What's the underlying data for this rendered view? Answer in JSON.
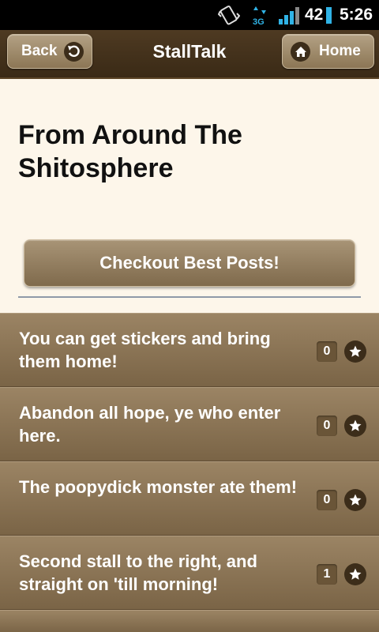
{
  "status_bar": {
    "battery": "42",
    "time": "5:26",
    "data_label": "3G",
    "icons": [
      "vibrate-icon",
      "data-3g-icon",
      "signal-icon",
      "battery-icon"
    ],
    "battery_color": "#30b3e6"
  },
  "header": {
    "back_label": "Back",
    "title": "StallTalk",
    "home_label": "Home",
    "icons": [
      "back-arrow-icon",
      "home-icon"
    ]
  },
  "main": {
    "title": "From Around The Shitosphere",
    "best_posts_label": "Checkout Best Posts!"
  },
  "posts": [
    {
      "text": "You can get stickers and bring them home!",
      "count": "0"
    },
    {
      "text": "Abandon all hope, ye who enter here.",
      "count": "0"
    },
    {
      "text": "The poopydick monster ate them!",
      "count": "0"
    },
    {
      "text": "Second stall to the right, and straight on 'till morning!",
      "count": "1"
    }
  ],
  "colors": {
    "header_bg": "#3a2a16",
    "page_bg": "#fdf6ea",
    "item_bg": "#8c7655",
    "icon_circle": "#3c2d1a"
  }
}
